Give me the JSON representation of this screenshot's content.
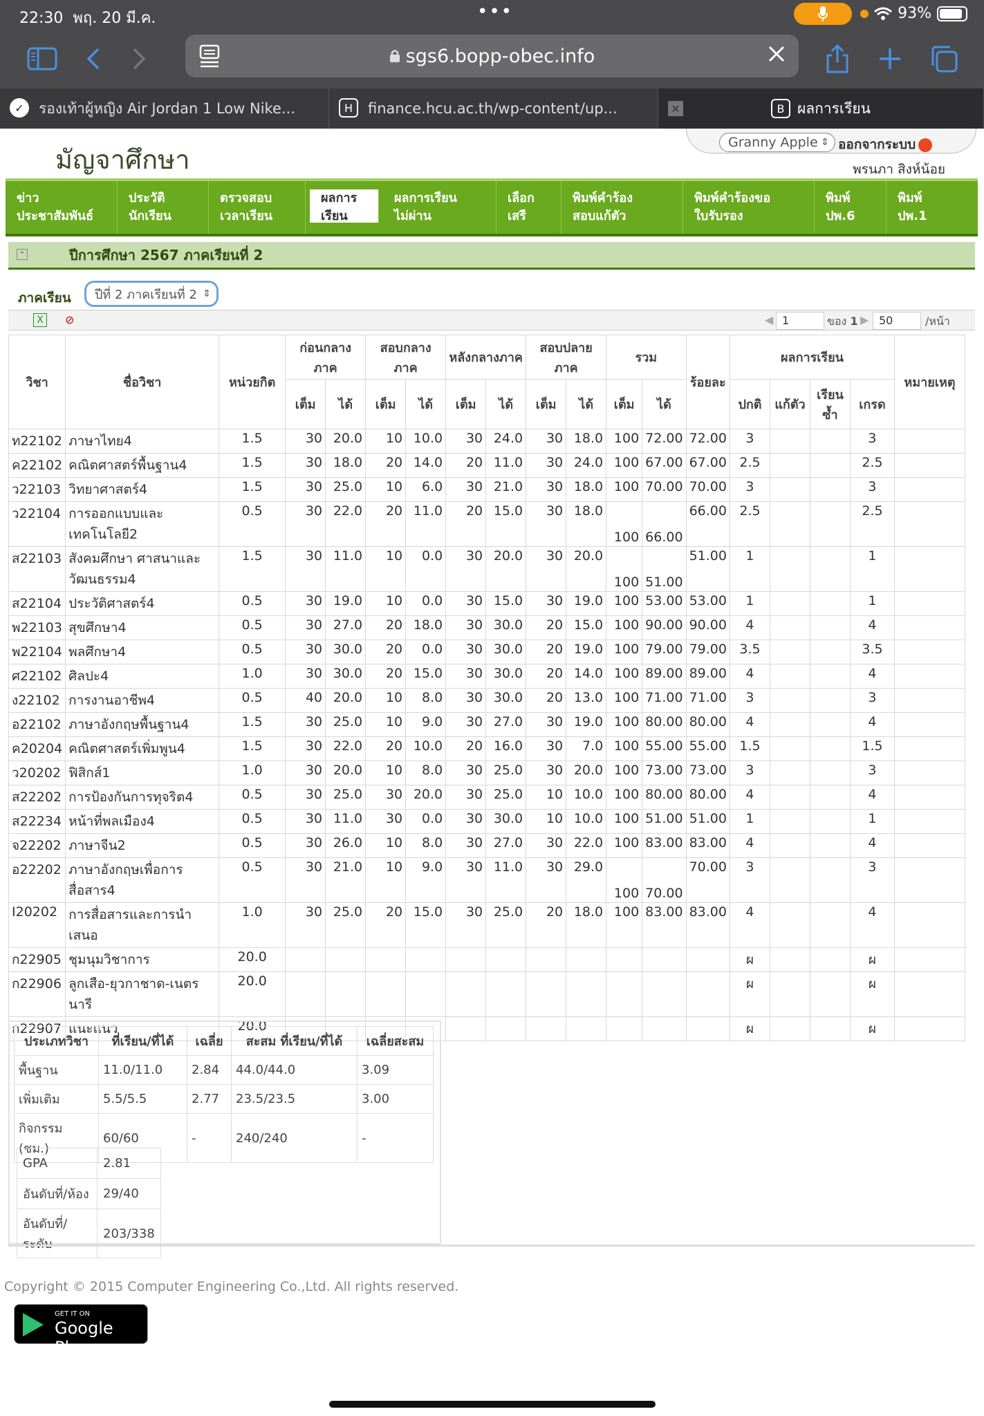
{
  "status": {
    "time": "22:30",
    "date": "พฤ. 20 มี.ค.",
    "battery": "93%"
  },
  "browser": {
    "url": "sgs6.bopp-obec.info"
  },
  "tabs": [
    {
      "label": "รองเท้าผู้หญิง Air Jordan 1 Low Nike..."
    },
    {
      "label": "finance.hcu.ac.th/wp-content/up...",
      "fav": "H"
    },
    {
      "label": "ผลการเรียน",
      "fav": "B"
    }
  ],
  "site": {
    "logo": "มัญจาศึกษา",
    "user_select": "Granny Apple",
    "logout": "ออกจากระบบ",
    "username": "พรนภา สิงห์น้อย"
  },
  "nav": [
    {
      "l1": "ข่าว",
      "l2": "ประชาสัมพันธ์"
    },
    {
      "l1": "ประวัติ",
      "l2": "นักเรียน"
    },
    {
      "l1": "ตรวจสอบ",
      "l2": "เวลาเรียน"
    },
    {
      "l1": "ผลการ",
      "l2": "เรียน"
    },
    {
      "l1": "ผลการเรียน",
      "l2": "ไม่ผ่าน"
    },
    {
      "l1": "เลือก",
      "l2": "เสรี"
    },
    {
      "l1": "พิมพ์คำร้อง",
      "l2": "สอบแก้ตัว"
    },
    {
      "l1": "พิมพ์คำร้องขอ",
      "l2": "ใบรับรอง"
    },
    {
      "l1": "พิมพ์",
      "l2": "ปพ.6"
    },
    {
      "l1": "พิมพ์",
      "l2": "ปพ.1"
    }
  ],
  "section_title": "ปีการศึกษา 2567 ภาคเรียนที่ 2",
  "term": {
    "label": "ภาคเรียน",
    "value": "ปีที่ 2 ภาคเรียนที่ 2"
  },
  "pager": {
    "page": "1",
    "of_label": "ของ",
    "total": "1",
    "per_page": "50",
    "per_label": "/หน้า"
  },
  "table": {
    "h_code": "วิชา",
    "h_name": "ชื่อวิชา",
    "h_credit": "หน่วยกิต",
    "h_pre_mid": "ก่อนกลางภาค",
    "h_mid": "สอบกลางภาค",
    "h_post_mid": "หลังกลางภาค",
    "h_final": "สอบปลายภาค",
    "h_total": "รวม",
    "h_percent": "ร้อยละ",
    "h_result": "ผลการเรียน",
    "h_note": "หมายเหตุ",
    "h_full": "เต็ม",
    "h_got": "ได้",
    "h_normal": "ปกติ",
    "h_fix": "แก้ตัว",
    "h_repeat": "เรียนซ้ำ",
    "h_grade": "เกรด",
    "rows": [
      [
        "ท22102",
        "ภาษาไทย4",
        "1.5",
        "30",
        "20.0",
        "10",
        "10.0",
        "30",
        "24.0",
        "30",
        "18.0",
        "100",
        "72.00",
        "72.00",
        "3",
        "3"
      ],
      [
        "ค22102",
        "คณิตศาสตร์พื้นฐาน4",
        "1.5",
        "30",
        "18.0",
        "20",
        "14.0",
        "20",
        "11.0",
        "30",
        "24.0",
        "100",
        "67.00",
        "67.00",
        "2.5",
        "2.5"
      ],
      [
        "ว22103",
        "วิทยาศาสตร์4",
        "1.5",
        "30",
        "25.0",
        "10",
        "6.0",
        "30",
        "21.0",
        "30",
        "18.0",
        "100",
        "70.00",
        "70.00",
        "3",
        "3"
      ],
      [
        "ว22104",
        "การออกแบบและเทคโนโลยี2",
        "0.5",
        "30",
        "22.0",
        "20",
        "11.0",
        "20",
        "15.0",
        "30",
        "18.0",
        "100",
        "66.00",
        "66.00",
        "2.5",
        "2.5"
      ],
      [
        "ส22103",
        "สังคมศึกษา ศาสนาและวัฒนธรรม4",
        "1.5",
        "30",
        "11.0",
        "10",
        "0.0",
        "30",
        "20.0",
        "30",
        "20.0",
        "100",
        "51.00",
        "51.00",
        "1",
        "1"
      ],
      [
        "ส22104",
        "ประวัติศาสตร์4",
        "0.5",
        "30",
        "19.0",
        "10",
        "0.0",
        "30",
        "15.0",
        "30",
        "19.0",
        "100",
        "53.00",
        "53.00",
        "1",
        "1"
      ],
      [
        "พ22103",
        "สุขศึกษา4",
        "0.5",
        "30",
        "27.0",
        "20",
        "18.0",
        "30",
        "30.0",
        "20",
        "15.0",
        "100",
        "90.00",
        "90.00",
        "4",
        "4"
      ],
      [
        "พ22104",
        "พลศึกษา4",
        "0.5",
        "30",
        "30.0",
        "20",
        "0.0",
        "30",
        "30.0",
        "20",
        "19.0",
        "100",
        "79.00",
        "79.00",
        "3.5",
        "3.5"
      ],
      [
        "ศ22102",
        "ศิลปะ4",
        "1.0",
        "30",
        "30.0",
        "20",
        "15.0",
        "30",
        "30.0",
        "20",
        "14.0",
        "100",
        "89.00",
        "89.00",
        "4",
        "4"
      ],
      [
        "ง22102",
        "การงานอาชีพ4",
        "0.5",
        "40",
        "20.0",
        "10",
        "8.0",
        "30",
        "30.0",
        "20",
        "13.0",
        "100",
        "71.00",
        "71.00",
        "3",
        "3"
      ],
      [
        "อ22102",
        "ภาษาอังกฤษพื้นฐาน4",
        "1.5",
        "30",
        "25.0",
        "10",
        "9.0",
        "30",
        "27.0",
        "30",
        "19.0",
        "100",
        "80.00",
        "80.00",
        "4",
        "4"
      ],
      [
        "ค20204",
        "คณิตศาสตร์เพิ่มพูน4",
        "1.5",
        "30",
        "22.0",
        "20",
        "10.0",
        "20",
        "16.0",
        "30",
        "7.0",
        "100",
        "55.00",
        "55.00",
        "1.5",
        "1.5"
      ],
      [
        "ว20202",
        "ฟิสิกส์1",
        "1.0",
        "30",
        "20.0",
        "10",
        "8.0",
        "30",
        "25.0",
        "30",
        "20.0",
        "100",
        "73.00",
        "73.00",
        "3",
        "3"
      ],
      [
        "ส22202",
        "การป้องกันการทุจริต4",
        "0.5",
        "30",
        "25.0",
        "30",
        "20.0",
        "30",
        "25.0",
        "10",
        "10.0",
        "100",
        "80.00",
        "80.00",
        "4",
        "4"
      ],
      [
        "ส22234",
        "หน้าที่พลเมือง4",
        "0.5",
        "30",
        "11.0",
        "30",
        "0.0",
        "30",
        "30.0",
        "10",
        "10.0",
        "100",
        "51.00",
        "51.00",
        "1",
        "1"
      ],
      [
        "จ22202",
        "ภาษาจีน2",
        "0.5",
        "30",
        "26.0",
        "10",
        "8.0",
        "30",
        "27.0",
        "30",
        "22.0",
        "100",
        "83.00",
        "83.00",
        "4",
        "4"
      ],
      [
        "อ22202",
        "ภาษาอังกฤษเพื่อการสื่อสาร4",
        "0.5",
        "30",
        "21.0",
        "10",
        "9.0",
        "30",
        "11.0",
        "30",
        "29.0",
        "100",
        "70.00",
        "70.00",
        "3",
        "3"
      ],
      [
        "I20202",
        "การสื่อสารและการนำเสนอ",
        "1.0",
        "30",
        "25.0",
        "20",
        "15.0",
        "30",
        "25.0",
        "20",
        "18.0",
        "100",
        "83.00",
        "83.00",
        "4",
        "4"
      ],
      [
        "ก22905",
        "ชุมนุมวิชาการ",
        "20.0",
        "",
        "",
        "",
        "",
        "",
        "",
        "",
        "",
        "",
        "",
        "",
        "ผ",
        "ผ"
      ],
      [
        "ก22906",
        "ลูกเสือ-ยุวกาชาด-เนตรนารี",
        "20.0",
        "",
        "",
        "",
        "",
        "",
        "",
        "",
        "",
        "",
        "",
        "",
        "ผ",
        "ผ"
      ],
      [
        "ก22907",
        "แนะแนว",
        "20.0",
        "",
        "",
        "",
        "",
        "",
        "",
        "",
        "",
        "",
        "",
        "",
        "ผ",
        "ผ"
      ]
    ]
  },
  "summary": {
    "headers": [
      "ประเภทวิชา",
      "ที่เรียน/ที่ได้",
      "เฉลี่ย",
      "สะสม ที่เรียน/ที่ได้",
      "เฉลี่ยสะสม"
    ],
    "rows": [
      [
        "พื้นฐาน",
        "11.0/11.0",
        "2.84",
        "44.0/44.0",
        "3.09"
      ],
      [
        "เพิ่มเติม",
        "5.5/5.5",
        "2.77",
        "23.5/23.5",
        "3.00"
      ],
      [
        "กิจกรรม (ชม.)",
        "60/60",
        "-",
        "240/240",
        "-"
      ]
    ]
  },
  "gpa": [
    [
      "GPA",
      "2.81"
    ],
    [
      "อันดับที่/ห้อง",
      "29/40"
    ],
    [
      "อันดับที่/ระดับ",
      "203/338"
    ]
  ],
  "footer": {
    "copyright": "Copyright © 2015 Computer Engineering Co.,Ltd. All rights reserved.",
    "gp_small": "GET IT ON",
    "gp_big": "Google Play"
  }
}
